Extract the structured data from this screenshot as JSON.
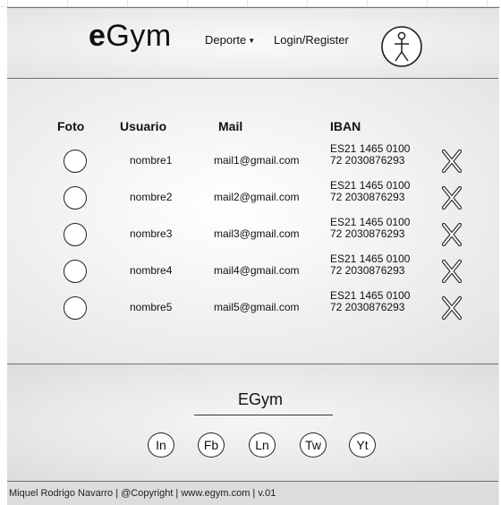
{
  "header": {
    "logo_bold": "e",
    "logo_rest": "Gym",
    "nav_deporte": "Deporte",
    "nav_login": "Login/Register",
    "user_icon": "user-accessibility-icon"
  },
  "table": {
    "columns": [
      "Foto",
      "Usuario",
      "Mail",
      "IBAN"
    ],
    "rows": [
      {
        "usuario": "nombre1",
        "mail": "mail1@gmail.com",
        "iban1": "ES21 1465 0100",
        "iban2": "72 2030876293"
      },
      {
        "usuario": "nombre2",
        "mail": "mail2@gmail.com",
        "iban1": "ES21 1465 0100",
        "iban2": "72 2030876293"
      },
      {
        "usuario": "nombre3",
        "mail": "mail3@gmail.com",
        "iban1": "ES21 1465 0100",
        "iban2": "72 2030876293"
      },
      {
        "usuario": "nombre4",
        "mail": "mail4@gmail.com",
        "iban1": "ES21 1465 0100",
        "iban2": "72 2030876293"
      },
      {
        "usuario": "nombre5",
        "mail": "mail5@gmail.com",
        "iban1": "ES21 1465 0100",
        "iban2": "72 2030876293"
      }
    ],
    "delete_icon": "x-delete-icon"
  },
  "footer": {
    "title": "EGym",
    "social": [
      "In",
      "Fb",
      "Ln",
      "Tw",
      "Yt"
    ],
    "copyright": "Miquel Rodrigo Navarro | @Copyright | www.egym.com | v.01"
  }
}
